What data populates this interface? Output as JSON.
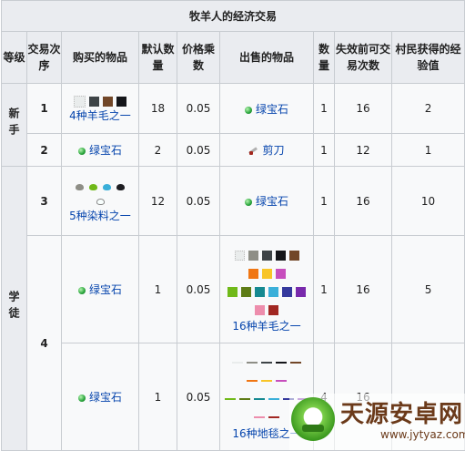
{
  "caption": "牧羊人的经济交易",
  "headers": {
    "level": "等级",
    "trade_order": "交易次序",
    "buy": "购买的物品",
    "default_qty": "默认数量",
    "price_mult": "价格乘数",
    "sell": "出售的物品",
    "qty": "数量",
    "max_uses": "失效前可交易次数",
    "xp": "村民获得的经验值"
  },
  "levels": {
    "novice": "新手",
    "apprentice": "学徒"
  },
  "rows": [
    {
      "order": "1",
      "buy": "4种羊毛之一",
      "default_qty": "18",
      "mult": "0.05",
      "sell": "绿宝石",
      "qty": "1",
      "uses": "16",
      "xp": "2"
    },
    {
      "order": "2",
      "buy": "绿宝石",
      "default_qty": "2",
      "mult": "0.05",
      "sell": "剪刀",
      "qty": "1",
      "uses": "12",
      "xp": "1"
    },
    {
      "order": "3",
      "buy": "5种染料之一",
      "default_qty": "12",
      "mult": "0.05",
      "sell": "绿宝石",
      "qty": "1",
      "uses": "16",
      "xp": "10"
    },
    {
      "order": "4",
      "buy": "绿宝石",
      "default_qty": "1",
      "mult": "0.05",
      "sell": "16种羊毛之一",
      "qty": "1",
      "uses": "16",
      "xp": "5"
    },
    {
      "order": "",
      "buy": "绿宝石",
      "default_qty": "1",
      "mult": "0.05",
      "sell": "16种地毯之一",
      "qty": "4",
      "uses": "16",
      "xp": ""
    }
  ],
  "wool_colors_4": [
    "#e9ecec",
    "#3e4447",
    "#724728",
    "#141519"
  ],
  "dye_colors_5": [
    "#8e8e86",
    "#70b919",
    "#3aafd9",
    "#1d1d21",
    "#f9fffe"
  ],
  "wool_colors_16": [
    "#e9ecec",
    "#8e8e86",
    "#3e4447",
    "#141519",
    "#724728",
    "#f07613",
    "#f8c527",
    "#c74ebd",
    "#70b919",
    "#5e7c16",
    "#158991",
    "#3aafd9",
    "#35399d",
    "#792aac",
    "#ed8dac",
    "#a12722"
  ],
  "watermark": {
    "name": "天源安卓网",
    "url": "www.jytyaz.com"
  }
}
